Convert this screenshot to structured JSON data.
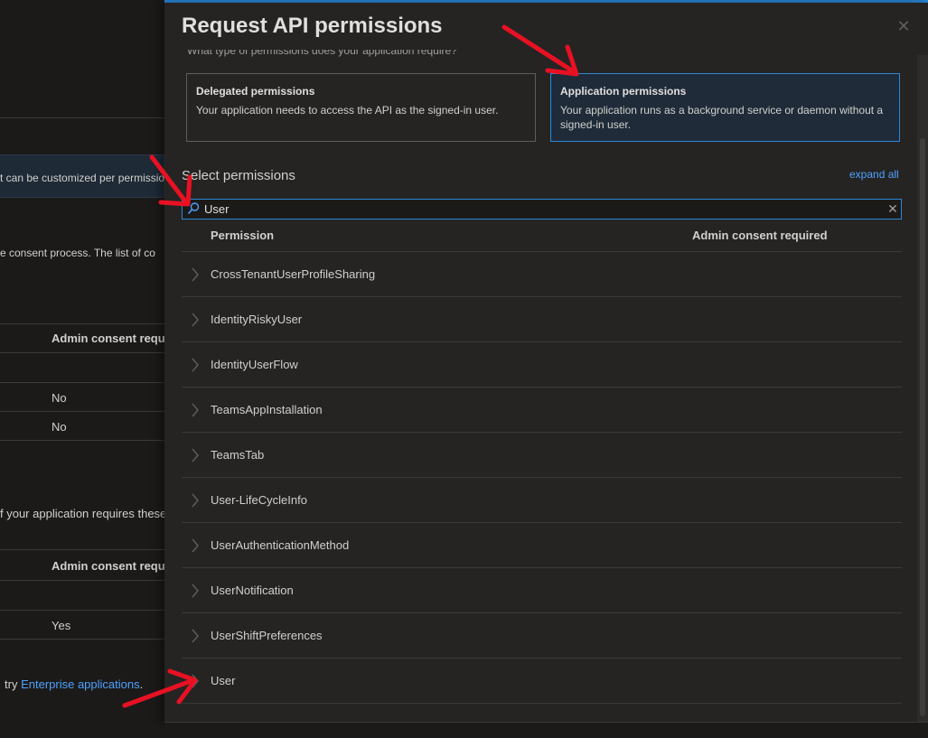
{
  "background": {
    "notice_text": "t can be customized per permission",
    "consent_text": "e consent process. The list of co",
    "table1": {
      "header": "Admin consent requ.",
      "values": [
        "No",
        "No"
      ]
    },
    "requires_text": "f your application requires these",
    "table2": {
      "header": "Admin consent requ.",
      "values": [
        "Yes"
      ]
    },
    "footer_prefix": "try",
    "footer_link": "Enterprise applications",
    "footer_suffix": "."
  },
  "panel": {
    "title": "Request API permissions",
    "close_label": "✕",
    "partial_text": "What type of permissions does your application require?",
    "permission_types": [
      {
        "title": "Delegated permissions",
        "description": "Your application needs to access the API as the signed-in user.",
        "selected": false
      },
      {
        "title": "Application permissions",
        "description": "Your application runs as a background service or daemon without a signed-in user.",
        "selected": true
      }
    ],
    "select_label": "Select permissions",
    "expand_all": "expand all",
    "search": {
      "value": "User",
      "clear_label": "✕"
    },
    "columns": [
      "Permission",
      "Admin consent required"
    ],
    "permissions": [
      "CrossTenantUserProfileSharing",
      "IdentityRiskyUser",
      "IdentityUserFlow",
      "TeamsAppInstallation",
      "TeamsTab",
      "User-LifeCycleInfo",
      "UserAuthenticationMethod",
      "UserNotification",
      "UserShiftPreferences",
      "User"
    ]
  },
  "colors": {
    "accent": "#2b88d8",
    "annotation": "#e81123",
    "link": "#4ea1ff"
  },
  "icons": {
    "search": "search-icon",
    "close": "close-icon",
    "clear": "clear-icon",
    "row_expand": "chevron-right-icon"
  }
}
